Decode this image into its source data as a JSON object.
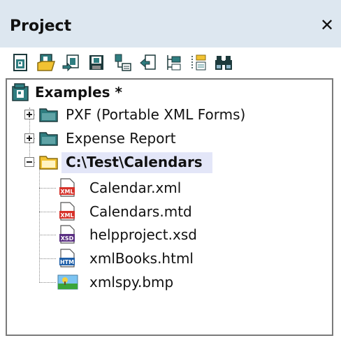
{
  "panel": {
    "title": "Project",
    "close_glyph": "✕"
  },
  "toolbar": {
    "buttons": [
      {
        "name": "new-project",
        "icon": "new-project-icon"
      },
      {
        "name": "open-project",
        "icon": "open-project-icon"
      },
      {
        "name": "reload-project",
        "icon": "reload-project-icon"
      },
      {
        "name": "save-project",
        "icon": "save-project-icon"
      },
      {
        "name": "add-files",
        "icon": "add-files-icon"
      },
      {
        "name": "add-active-file",
        "icon": "add-active-file-icon"
      },
      {
        "name": "add-external-folder",
        "icon": "add-external-folder-icon"
      },
      {
        "name": "add-folder",
        "icon": "add-folder-icon"
      },
      {
        "name": "find",
        "icon": "binoculars-icon"
      }
    ]
  },
  "tree": {
    "root": {
      "label": "Examples *",
      "icon": "project-icon"
    },
    "folders": [
      {
        "label": "PXF (Portable XML Forms)",
        "expanded": false,
        "icon": "folder-icon"
      },
      {
        "label": "Expense Report",
        "expanded": false,
        "icon": "folder-icon"
      },
      {
        "label": "C:\\Test\\Calendars",
        "expanded": true,
        "selected": true,
        "icon": "open-folder-icon"
      }
    ],
    "files": [
      {
        "label": "Calendar.xml",
        "icon": "xml-file-icon",
        "badge": "XML"
      },
      {
        "label": "Calendars.mtd",
        "icon": "xml-file-icon",
        "badge": "XML"
      },
      {
        "label": "helpproject.xsd",
        "icon": "xsd-file-icon",
        "badge": "XSD"
      },
      {
        "label": "xmlBooks.html",
        "icon": "html-file-icon",
        "badge": "HTM"
      },
      {
        "label": "xmlspy.bmp",
        "icon": "image-file-icon"
      }
    ]
  },
  "colors": {
    "titlebar": "#dde7f0",
    "selection": "#e3e6f8",
    "folder_teal": "#2f7d80",
    "folder_yellow": "#f1c232",
    "xml_red": "#d6322a",
    "xsd_purple": "#5a2f82",
    "htm_blue": "#1f5fa8"
  }
}
